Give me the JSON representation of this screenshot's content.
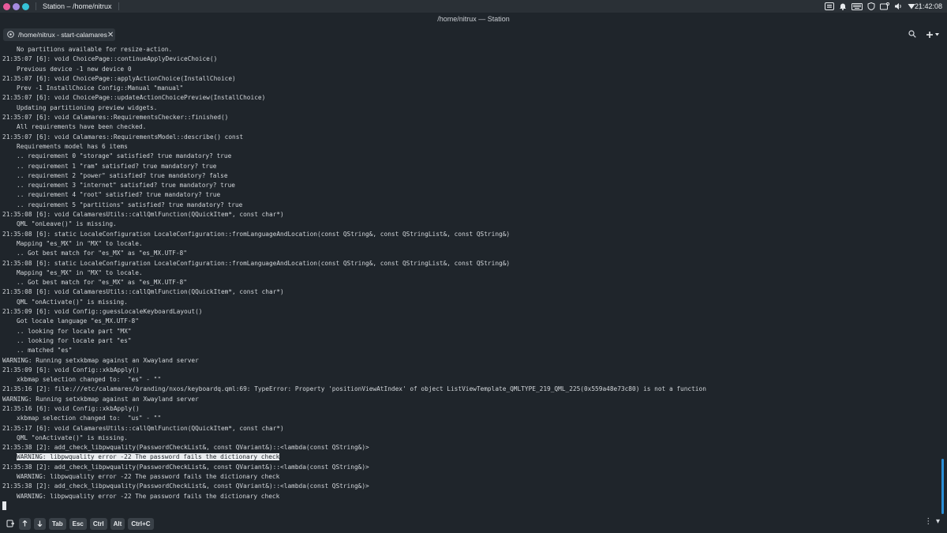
{
  "top_panel": {
    "dot_colors": [
      "#e85a9b",
      "#a48be0",
      "#35c2d6"
    ],
    "app_title": "Station – /home/nitrux",
    "tray_icons": [
      "keyboard-icon",
      "bell-icon",
      "input-icon",
      "shield-icon",
      "storage-icon",
      "volume-icon",
      "network-icon"
    ],
    "clock": "21:42:08"
  },
  "window": {
    "title": "/home/nitrux — Station"
  },
  "tabs": [
    {
      "label": "/home/nitrux - start-calamares",
      "icon": "terminal-icon"
    }
  ],
  "accent": "#2b8fd6",
  "terminal": {
    "lines": [
      {
        "indent": true,
        "text": "No partitions available for resize-action."
      },
      {
        "indent": false,
        "text": "21:35:07 [6]: void ChoicePage::continueApplyDeviceChoice()"
      },
      {
        "indent": true,
        "text": "Previous device -1 new device 0"
      },
      {
        "indent": false,
        "text": "21:35:07 [6]: void ChoicePage::applyActionChoice(InstallChoice)"
      },
      {
        "indent": true,
        "text": "Prev -1 InstallChoice Config::Manual \"manual\""
      },
      {
        "indent": false,
        "text": "21:35:07 [6]: void ChoicePage::updateActionChoicePreview(InstallChoice)"
      },
      {
        "indent": true,
        "text": "Updating partitioning preview widgets."
      },
      {
        "indent": false,
        "text": "21:35:07 [6]: void Calamares::RequirementsChecker::finished()"
      },
      {
        "indent": true,
        "text": "All requirements have been checked."
      },
      {
        "indent": false,
        "text": "21:35:07 [6]: void Calamares::RequirementsModel::describe() const"
      },
      {
        "indent": true,
        "text": "Requirements model has 6 items"
      },
      {
        "indent": true,
        "text": ".. requirement 0 \"storage\" satisfied? true mandatory? true"
      },
      {
        "indent": true,
        "text": ".. requirement 1 \"ram\" satisfied? true mandatory? true"
      },
      {
        "indent": true,
        "text": ".. requirement 2 \"power\" satisfied? true mandatory? false"
      },
      {
        "indent": true,
        "text": ".. requirement 3 \"internet\" satisfied? true mandatory? true"
      },
      {
        "indent": true,
        "text": ".. requirement 4 \"root\" satisfied? true mandatory? true"
      },
      {
        "indent": true,
        "text": ".. requirement 5 \"partitions\" satisfied? true mandatory? true"
      },
      {
        "indent": false,
        "text": "21:35:08 [6]: void CalamaresUtils::callQmlFunction(QQuickItem*, const char*)"
      },
      {
        "indent": true,
        "text": "QML \"onLeave()\" is missing."
      },
      {
        "indent": false,
        "text": "21:35:08 [6]: static LocaleConfiguration LocaleConfiguration::fromLanguageAndLocation(const QString&, const QStringList&, const QString&)"
      },
      {
        "indent": true,
        "text": "Mapping \"es_MX\" in \"MX\" to locale."
      },
      {
        "indent": true,
        "text": ".. Got best match for \"es_MX\" as \"es_MX.UTF-8\""
      },
      {
        "indent": false,
        "text": "21:35:08 [6]: static LocaleConfiguration LocaleConfiguration::fromLanguageAndLocation(const QString&, const QStringList&, const QString&)"
      },
      {
        "indent": true,
        "text": "Mapping \"es_MX\" in \"MX\" to locale."
      },
      {
        "indent": true,
        "text": ".. Got best match for \"es_MX\" as \"es_MX.UTF-8\""
      },
      {
        "indent": false,
        "text": "21:35:08 [6]: void CalamaresUtils::callQmlFunction(QQuickItem*, const char*)"
      },
      {
        "indent": true,
        "text": "QML \"onActivate()\" is missing."
      },
      {
        "indent": false,
        "text": "21:35:09 [6]: void Config::guessLocaleKeyboardLayout()"
      },
      {
        "indent": true,
        "text": "Got locale language \"es_MX.UTF-8\""
      },
      {
        "indent": true,
        "text": ".. looking for locale part \"MX\""
      },
      {
        "indent": true,
        "text": ".. looking for locale part \"es\""
      },
      {
        "indent": true,
        "text": ".. matched \"es\""
      },
      {
        "indent": false,
        "text": "WARNING: Running setxkbmap against an Xwayland server"
      },
      {
        "indent": false,
        "text": "21:35:09 [6]: void Config::xkbApply()"
      },
      {
        "indent": true,
        "text": "xkbmap selection changed to:  \"es\" - \"\""
      },
      {
        "indent": false,
        "text": "21:35:16 [2]: file:///etc/calamares/branding/nxos/keyboardq.qml:69: TypeError: Property 'positionViewAtIndex' of object ListViewTemplate_QMLTYPE_219_QML_225(0x559a48e73c80) is not a function"
      },
      {
        "indent": false,
        "text": "WARNING: Running setxkbmap against an Xwayland server"
      },
      {
        "indent": false,
        "text": "21:35:16 [6]: void Config::xkbApply()"
      },
      {
        "indent": true,
        "text": "xkbmap selection changed to:  \"us\" - \"\""
      },
      {
        "indent": false,
        "text": "21:35:17 [6]: void CalamaresUtils::callQmlFunction(QQuickItem*, const char*)"
      },
      {
        "indent": true,
        "text": "QML \"onActivate()\" is missing."
      },
      {
        "indent": false,
        "text": "21:35:38 [2]: add_check_libpwquality(PasswordCheckList&, const QVariant&)::<lambda(const QString&)>"
      },
      {
        "indent": true,
        "text": "WARNING: libpwquality error -22 The password fails the dictionary check",
        "highlight": true
      },
      {
        "indent": false,
        "text": "21:35:38 [2]: add_check_libpwquality(PasswordCheckList&, const QVariant&)::<lambda(const QString&)>"
      },
      {
        "indent": true,
        "text": "WARNING: libpwquality error -22 The password fails the dictionary check"
      },
      {
        "indent": false,
        "text": "21:35:38 [2]: add_check_libpwquality(PasswordCheckList&, const QVariant&)::<lambda(const QString&)>"
      },
      {
        "indent": true,
        "text": "WARNING: libpwquality error -22 The password fails the dictionary check"
      }
    ]
  },
  "bottom_bar": {
    "keys": [
      "Tab",
      "Esc",
      "Ctrl",
      "Alt",
      "Ctrl+C"
    ],
    "icons": [
      "new-doc-icon",
      "arrow-up-icon",
      "arrow-down-icon"
    ],
    "menu_label": "⋮ ▾"
  }
}
